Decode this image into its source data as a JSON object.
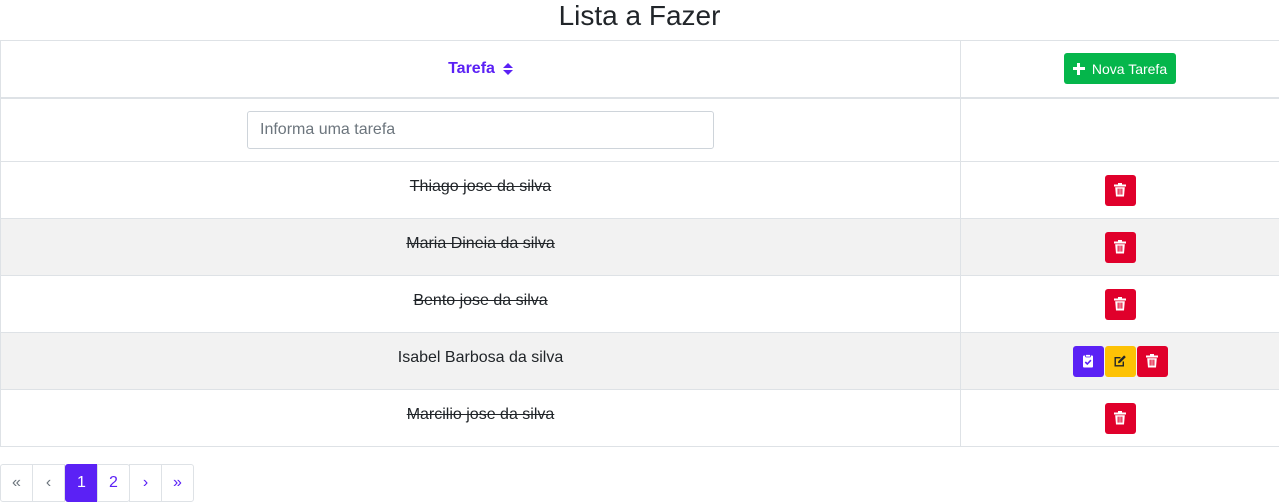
{
  "header": {
    "title": "Lista a Fazer"
  },
  "table": {
    "column_task": "Tarefa",
    "new_button_label": "Nova Tarefa",
    "filter_placeholder": "Informa uma tarefa",
    "rows": [
      {
        "name": "Thiago jose da silva",
        "done": true
      },
      {
        "name": "Maria Dineia da silva",
        "done": true
      },
      {
        "name": "Bento jose da silva",
        "done": true
      },
      {
        "name": "Isabel Barbosa da silva",
        "done": false
      },
      {
        "name": "Marcilio jose da silva",
        "done": true
      }
    ]
  },
  "pagination": {
    "first": "«",
    "prev": "‹",
    "pages": [
      "1",
      "2"
    ],
    "current": "1",
    "next": "›",
    "last": "»"
  },
  "colors": {
    "accent": "#5b21f5",
    "success": "#05b64b",
    "danger": "#e0002b",
    "warning": "#fdc205"
  },
  "icons": {
    "sort": "sort-icon",
    "new": "plus-icon",
    "delete": "trash-icon",
    "complete": "clipboard-check-icon",
    "edit": "edit-icon"
  }
}
